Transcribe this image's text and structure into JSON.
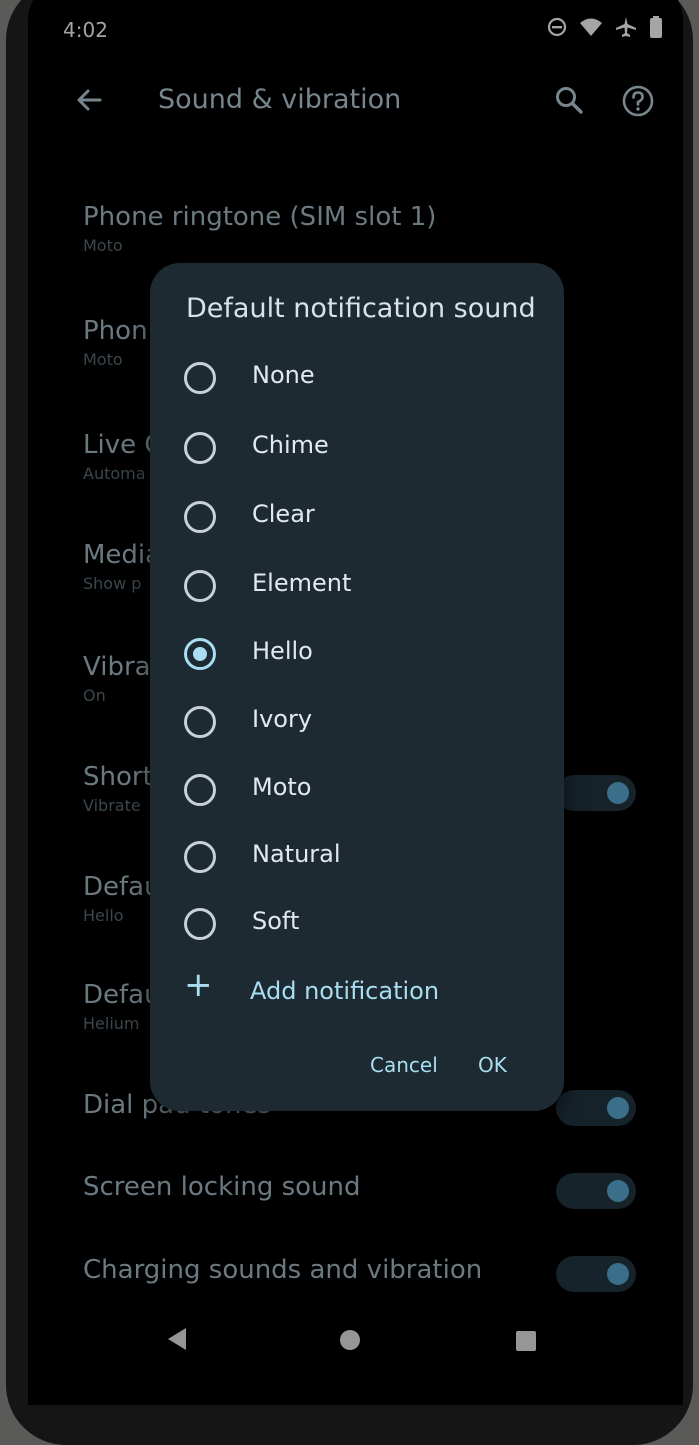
{
  "status_bar": {
    "time": "4:02",
    "icons": [
      "do-not-disturb-icon",
      "wifi-icon",
      "airplane-icon",
      "battery-icon"
    ]
  },
  "app_bar": {
    "title": "Sound & vibration",
    "icons": [
      "back-arrow-icon",
      "search-icon",
      "help-icon"
    ]
  },
  "settings": [
    {
      "title": "Phone ringtone (SIM slot 1)",
      "subtitle": "Moto"
    },
    {
      "title": "Phon",
      "subtitle": "Moto"
    },
    {
      "title": "Live C",
      "subtitle": "Automa"
    },
    {
      "title": "Media",
      "subtitle": "Show p"
    },
    {
      "title": "Vibra",
      "subtitle": "On"
    },
    {
      "title": "Short",
      "subtitle": "Vibrate",
      "toggle": true
    },
    {
      "title": "Defau",
      "subtitle": "Hello"
    },
    {
      "title": "Defau",
      "subtitle": "Helium"
    },
    {
      "title": "Dial pad tones",
      "toggle": true
    },
    {
      "title": "Screen locking sound",
      "toggle": true
    },
    {
      "title": "Charging sounds and vibration",
      "toggle": true
    }
  ],
  "dialog": {
    "title": "Default notification sound",
    "options": [
      {
        "label": "None",
        "selected": false
      },
      {
        "label": "Chime",
        "selected": false
      },
      {
        "label": "Clear",
        "selected": false
      },
      {
        "label": "Element",
        "selected": false
      },
      {
        "label": "Hello",
        "selected": true
      },
      {
        "label": "Ivory",
        "selected": false
      },
      {
        "label": "Moto",
        "selected": false
      },
      {
        "label": "Natural",
        "selected": false
      },
      {
        "label": "Soft",
        "selected": false
      }
    ],
    "add_label": "Add notification",
    "cancel_label": "Cancel",
    "ok_label": "OK"
  },
  "colors": {
    "accent": "#a9ddf1",
    "dialog_bg": "#1d2a32",
    "toggle_on": "#4f93b6"
  }
}
